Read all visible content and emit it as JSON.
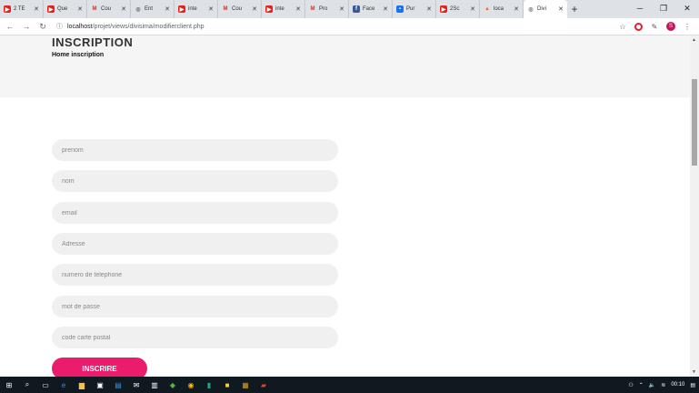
{
  "browser": {
    "tabs": [
      {
        "label": "2 TE",
        "icon": "youtube-icon",
        "color": "#e62117"
      },
      {
        "label": "Que",
        "icon": "youtube-icon",
        "color": "#e62117"
      },
      {
        "label": "Cou",
        "icon": "gmail-icon",
        "color": "#d93025"
      },
      {
        "label": "Ent",
        "icon": "globe-icon",
        "color": "#5f6368"
      },
      {
        "label": "inte",
        "icon": "youtube-icon",
        "color": "#e62117"
      },
      {
        "label": "Cou",
        "icon": "gmail-icon",
        "color": "#d93025"
      },
      {
        "label": "inte",
        "icon": "youtube-icon",
        "color": "#e62117"
      },
      {
        "label": "Pro",
        "icon": "gmail-icon",
        "color": "#d93025"
      },
      {
        "label": "Face",
        "icon": "facebook-icon",
        "color": "#3b5998"
      },
      {
        "label": "Pur",
        "icon": "site-icon",
        "color": "#1a73e8"
      },
      {
        "label": "2Sc",
        "icon": "youtube-icon",
        "color": "#e62117"
      },
      {
        "label": "loca",
        "icon": "xampp-icon",
        "color": "#e8702a"
      },
      {
        "label": "Divi",
        "icon": "globe-icon",
        "color": "#5f6368",
        "active": true
      }
    ],
    "url_host": "localhost",
    "url_path": "/projet/views/divisima/modifierclient.php",
    "avatar_letter": "S"
  },
  "page": {
    "title": "INSCRIPTION",
    "breadcrumb": "Home inscription",
    "fields": [
      {
        "placeholder": "prenom"
      },
      {
        "placeholder": "nom"
      },
      {
        "placeholder": "email"
      },
      {
        "placeholder": "Adresse"
      },
      {
        "placeholder": "numero de telephone"
      },
      {
        "placeholder": "mot de passe"
      },
      {
        "placeholder": "code carte postal"
      }
    ],
    "submit_label": "INSCRIRE",
    "accent_color": "#ec1c6c"
  },
  "taskbar": {
    "clock": "00:10"
  }
}
